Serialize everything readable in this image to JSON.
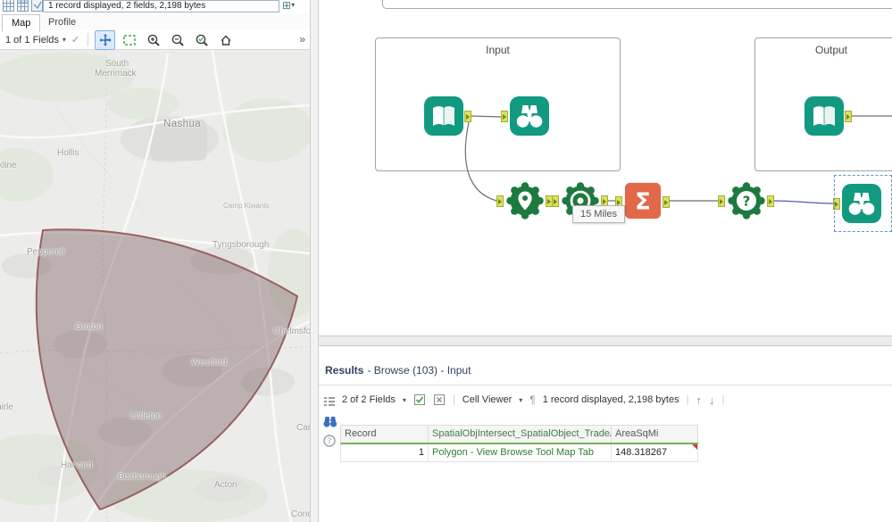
{
  "browse_panel": {
    "mini_toolbar": {
      "record_info": "1 record displayed, 2 fields, 2,198 bytes",
      "add_icon": "⊞",
      "caret": "▾"
    },
    "tabs": {
      "map": "Map",
      "profile": "Profile"
    },
    "fields_bar": {
      "fields_label": "1 of 1 Fields",
      "caret": "▾",
      "check": "✓",
      "overflow": "»"
    },
    "map_labels": {
      "south": "South",
      "merrimack": "Merrimack",
      "nashua": "Nashua",
      "hollis": "Hollis",
      "brookline_fragment": "kline",
      "camp": "Camp Kiwanis",
      "tyngsborough": "Tyngsborough",
      "pepperell": "Pepperell",
      "groton": "Groton",
      "westford": "Westford",
      "chelmsford_fragment": "Chelmsfor",
      "littleton": "Littleton",
      "carlisle_fragment": "Carli",
      "shirley_fragment": "hirle",
      "harvard": "Harvard",
      "boxborough": "Boxborough",
      "acton": "Acton",
      "concord_fragment": "Conc"
    },
    "polygon": {
      "fill": "rgba(122,96,96,0.42)",
      "stroke": "#99605f"
    }
  },
  "canvas": {
    "containers": {
      "input": "Input",
      "output": "Output"
    },
    "annotation": "15 Miles",
    "tool_glyphs": {
      "summarize_sigma": "Σ",
      "question_mark": "?"
    },
    "icons": {
      "input_data": "input-data-book-icon",
      "browse": "browse-binoculars-icon",
      "create_points": "spatial-pin-icon",
      "trade_area": "trade-area-target-icon",
      "summarize": "summarize-sigma-icon",
      "spatial_process": "spatial-question-icon"
    },
    "colors": {
      "teal": "#119a80",
      "green": "#1d7a3e",
      "orange": "#e2684a",
      "anchor": "#d9e25a",
      "wire_blue": "#4e5ab0"
    }
  },
  "results": {
    "title": "Results",
    "subtitle": "- Browse (103) - Input",
    "toolbar": {
      "fields": "2 of 2 Fields",
      "caret": "▾",
      "cell_viewer": "Cell Viewer",
      "pilcrow": "¶",
      "record_info": "1 record displayed, 2,198 bytes",
      "up": "↑",
      "down": "↓",
      "sep": "|"
    },
    "icons": {
      "help": "?"
    },
    "table": {
      "headers": [
        "Record",
        "SpatialObjIntersect_SpatialObject_TradeArea",
        "AreaSqMi"
      ],
      "rows": [
        [
          "1",
          "Polygon - View Browse Tool Map Tab",
          "148.318267"
        ]
      ]
    }
  }
}
